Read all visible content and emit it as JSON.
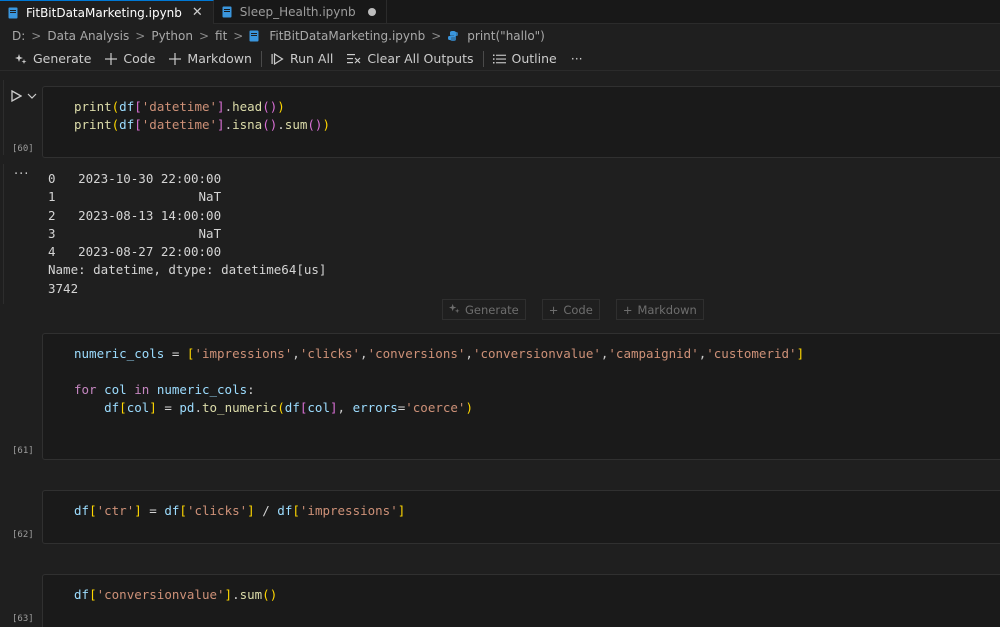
{
  "tabs": [
    {
      "label": "FitBitDataMarketing.ipynb",
      "active": true,
      "close": "✕"
    },
    {
      "label": "Sleep_Health.ipynb",
      "active": false
    }
  ],
  "breadcrumb": {
    "items": [
      "D:",
      "Data Analysis",
      "Python",
      "fit",
      "FitBitDataMarketing.ipynb",
      "print(\"hallo\")"
    ],
    "separator": ">"
  },
  "toolbar": {
    "generate": "Generate",
    "code": "Code",
    "markdown": "Markdown",
    "run_all": "Run All",
    "clear_all_outputs": "Clear All Outputs",
    "outline": "Outline",
    "more": "···"
  },
  "cells": {
    "c60": {
      "exec": "[60]"
    },
    "c61": {
      "exec": "[61]"
    },
    "c62": {
      "exec": "[62]"
    },
    "c63": {
      "exec": "[63]"
    }
  },
  "output": {
    "more": "···",
    "lines": [
      "0   2023-10-30 22:00:00",
      "1                   NaT",
      "2   2023-08-13 14:00:00",
      "3                   NaT",
      "4   2023-08-27 22:00:00",
      "Name: datetime, dtype: datetime64[us]",
      "3742"
    ]
  },
  "insert_bar": {
    "generate": "Generate",
    "code": "Code",
    "markdown": "Markdown"
  },
  "code_strings": {
    "datetime": "'datetime'",
    "impressions": "'impressions'",
    "clicks": "'clicks'",
    "conversions": "'conversions'",
    "conversionvalue": "'conversionvalue'",
    "campaignid": "'campaignid'",
    "customerid": "'customerid'",
    "coerce": "'coerce'",
    "ctr": "'ctr'"
  },
  "colors": {
    "accent": "#0078d4",
    "keyword": "#c586c0",
    "string": "#ce9178",
    "function": "#dcdcaa",
    "variable": "#9cdcfe"
  }
}
